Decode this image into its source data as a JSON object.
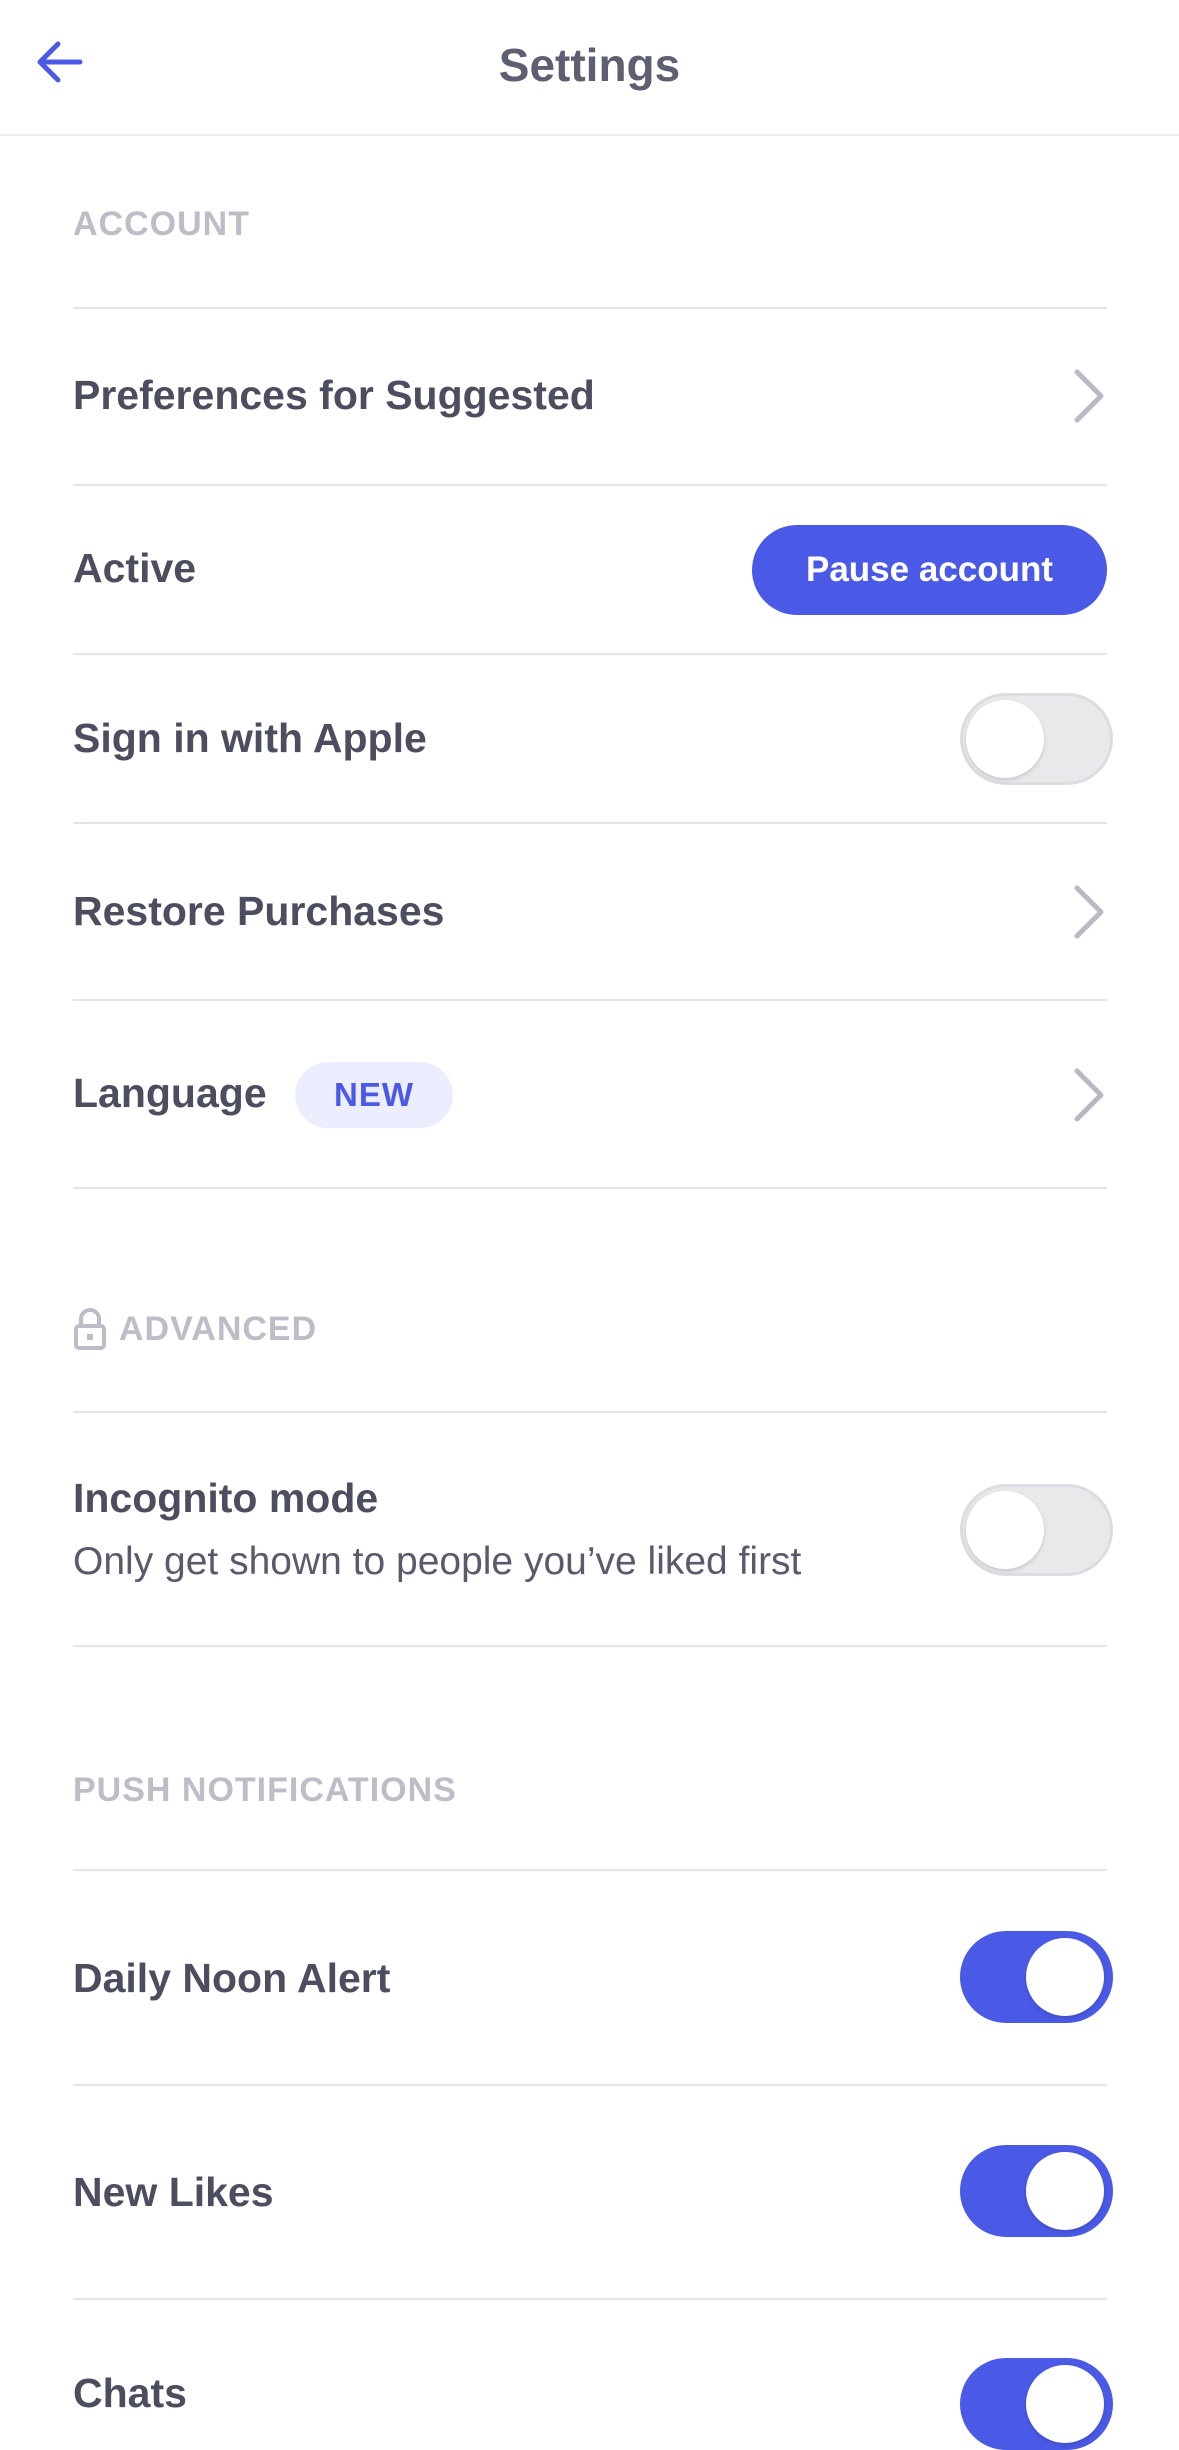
{
  "header": {
    "title": "Settings",
    "back_icon": "arrow-left-icon"
  },
  "colors": {
    "accent": "#4a5ae6",
    "section_label": "#bdbdc8",
    "divider": "#e4e4ea",
    "badge_bg": "#eceeff"
  },
  "account": {
    "section_label": "ACCOUNT",
    "preferences_label": "Preferences for Suggested",
    "active_label": "Active",
    "pause_button_label": "Pause account",
    "sign_in_apple_label": "Sign in with Apple",
    "sign_in_apple_on": false,
    "restore_purchases_label": "Restore Purchases",
    "language_label": "Language",
    "language_badge": "NEW"
  },
  "advanced": {
    "section_label": "ADVANCED",
    "section_icon": "lock-icon",
    "incognito_label": "Incognito mode",
    "incognito_sub": "Only get shown to people you’ve liked first",
    "incognito_on": false
  },
  "push": {
    "section_label": "PUSH NOTIFICATIONS",
    "daily_noon_label": "Daily Noon Alert",
    "daily_noon_on": true,
    "new_likes_label": "New Likes",
    "new_likes_on": true,
    "chats_label": "Chats",
    "chats_on": true
  }
}
